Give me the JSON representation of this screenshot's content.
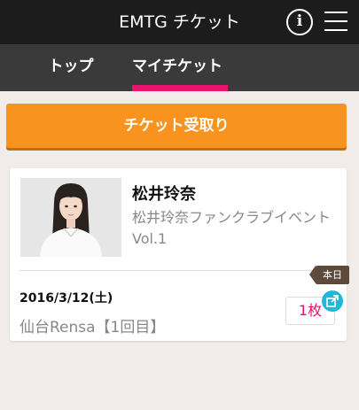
{
  "header": {
    "title": "EMTG チケット",
    "info_icon": "info-icon",
    "menu_icon": "hamburger-menu-icon"
  },
  "tabs": [
    {
      "label": "トップ",
      "active": false
    },
    {
      "label": "マイチケット",
      "active": true
    }
  ],
  "actions": {
    "receive_label": "チケット受取り"
  },
  "ticket": {
    "artist": "松井玲奈",
    "event": "松井玲奈ファンクラブイベント Vol.1",
    "badge": "本日",
    "date": "2016/3/12(土)",
    "venue": "仙台Rensa【1回目】",
    "count": "1枚",
    "share_icon": "share-icon"
  },
  "colors": {
    "header_bg": "#1c1c1c",
    "tab_bg": "#3a3a3a",
    "accent_pink": "#e6146c",
    "button_orange": "#f7931e",
    "badge_brown": "#5c4a3c",
    "share_cyan": "#21b7d6",
    "page_bg": "#f1ece9"
  }
}
